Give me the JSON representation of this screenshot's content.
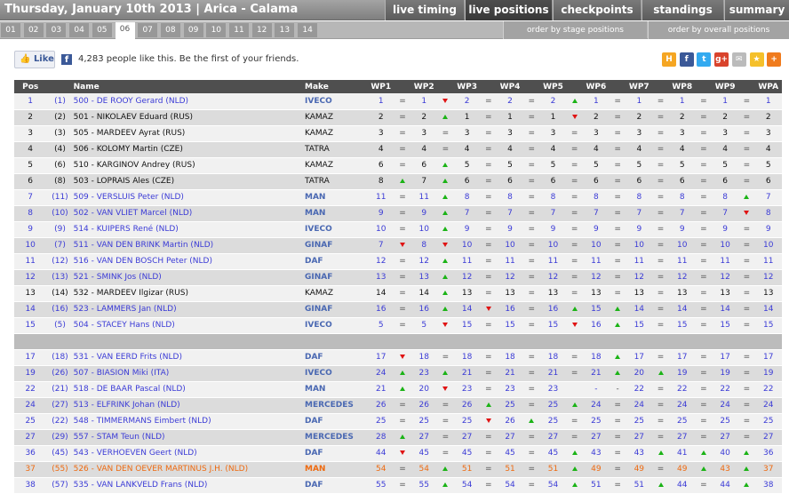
{
  "header": {
    "title": "Thursday, January 10th 2013 | Arica - Calama",
    "tabs": [
      "live timing",
      "live positions",
      "checkpoints",
      "standings",
      "summary"
    ],
    "active_tab": "live positions"
  },
  "stages": {
    "items": [
      "01",
      "02",
      "03",
      "04",
      "05",
      "06",
      "07",
      "08",
      "09",
      "10",
      "11",
      "12",
      "13",
      "14"
    ],
    "active": "06",
    "order_stage": "order by stage positions",
    "order_overall": "order by overall positions"
  },
  "facebook": {
    "like_label": "Like",
    "fb_glyph": "f",
    "like_text": "4,283 people like this. Be the first of your friends."
  },
  "share_icons": [
    {
      "name": "hyves-icon",
      "glyph": "H",
      "color": "#f5a623"
    },
    {
      "name": "facebook-share-icon",
      "glyph": "f",
      "color": "#3b5998"
    },
    {
      "name": "twitter-icon",
      "glyph": "t",
      "color": "#33aaf0"
    },
    {
      "name": "google-plus-icon",
      "glyph": "g+",
      "color": "#d9432c"
    },
    {
      "name": "email-icon",
      "glyph": "✉",
      "color": "#bbbbbb"
    },
    {
      "name": "favorite-star-icon",
      "glyph": "★",
      "color": "#f5c02b"
    },
    {
      "name": "more-plus-icon",
      "glyph": "+",
      "color": "#f07b1d"
    }
  ],
  "table": {
    "headers": {
      "pos": "Pos",
      "name": "Name",
      "make": "Make",
      "wps": [
        "WP1",
        "WP2",
        "WP3",
        "WP4",
        "WP5",
        "WP6",
        "WP7",
        "WP8",
        "WP9",
        "WPA"
      ]
    },
    "rows": [
      {
        "pos": "1",
        "ov": "(1)",
        "name": "500 - DE ROOY Gerard (NLD)",
        "make": "IVECO",
        "style": "blue",
        "wp": [
          "1",
          "1",
          "2",
          "2",
          "2",
          "1",
          "1",
          "1",
          "1",
          "1"
        ],
        "ch": [
          "=",
          "v",
          "=",
          "=",
          "^",
          "=",
          "=",
          "=",
          "="
        ]
      },
      {
        "pos": "2",
        "ov": "(2)",
        "name": "501 - NIKOLAEV Eduard (RUS)",
        "make": "KAMAZ",
        "style": "black",
        "wp": [
          "2",
          "2",
          "1",
          "1",
          "1",
          "2",
          "2",
          "2",
          "2",
          "2"
        ],
        "ch": [
          "=",
          "^",
          "=",
          "=",
          "v",
          "=",
          "=",
          "=",
          "="
        ]
      },
      {
        "pos": "3",
        "ov": "(3)",
        "name": "505 - MARDEEV Ayrat (RUS)",
        "make": "KAMAZ",
        "style": "black",
        "wp": [
          "3",
          "3",
          "3",
          "3",
          "3",
          "3",
          "3",
          "3",
          "3",
          "3"
        ],
        "ch": [
          "=",
          "=",
          "=",
          "=",
          "=",
          "=",
          "=",
          "=",
          "="
        ]
      },
      {
        "pos": "4",
        "ov": "(4)",
        "name": "506 - KOLOMY Martin (CZE)",
        "make": "TATRA",
        "style": "black",
        "wp": [
          "4",
          "4",
          "4",
          "4",
          "4",
          "4",
          "4",
          "4",
          "4",
          "4"
        ],
        "ch": [
          "=",
          "=",
          "=",
          "=",
          "=",
          "=",
          "=",
          "=",
          "="
        ]
      },
      {
        "pos": "5",
        "ov": "(6)",
        "name": "510 - KARGINOV Andrey (RUS)",
        "make": "KAMAZ",
        "style": "black",
        "wp": [
          "6",
          "6",
          "5",
          "5",
          "5",
          "5",
          "5",
          "5",
          "5",
          "5"
        ],
        "ch": [
          "=",
          "^",
          "=",
          "=",
          "=",
          "=",
          "=",
          "=",
          "="
        ]
      },
      {
        "pos": "6",
        "ov": "(8)",
        "name": "503 - LOPRAIS Ales (CZE)",
        "make": "TATRA",
        "style": "black",
        "wp": [
          "8",
          "7",
          "6",
          "6",
          "6",
          "6",
          "6",
          "6",
          "6",
          "6"
        ],
        "ch": [
          "^",
          "^",
          "=",
          "=",
          "=",
          "=",
          "=",
          "=",
          "="
        ]
      },
      {
        "pos": "7",
        "ov": "(11)",
        "name": "509 - VERSLUIS Peter (NLD)",
        "make": "MAN",
        "style": "blue",
        "wp": [
          "11",
          "11",
          "8",
          "8",
          "8",
          "8",
          "8",
          "8",
          "8",
          "7"
        ],
        "ch": [
          "=",
          "^",
          "=",
          "=",
          "=",
          "=",
          "=",
          "=",
          "^"
        ]
      },
      {
        "pos": "8",
        "ov": "(10)",
        "name": "502 - VAN VLIET Marcel (NLD)",
        "make": "MAN",
        "style": "blue",
        "wp": [
          "9",
          "9",
          "7",
          "7",
          "7",
          "7",
          "7",
          "7",
          "7",
          "8"
        ],
        "ch": [
          "=",
          "^",
          "=",
          "=",
          "=",
          "=",
          "=",
          "=",
          "v"
        ]
      },
      {
        "pos": "9",
        "ov": "(9)",
        "name": "514 - KUIPERS René (NLD)",
        "make": "IVECO",
        "style": "blue",
        "wp": [
          "10",
          "10",
          "9",
          "9",
          "9",
          "9",
          "9",
          "9",
          "9",
          "9"
        ],
        "ch": [
          "=",
          "^",
          "=",
          "=",
          "=",
          "=",
          "=",
          "=",
          "="
        ]
      },
      {
        "pos": "10",
        "ov": "(7)",
        "name": "511 - VAN DEN BRINK Martin (NLD)",
        "make": "GINAF",
        "style": "blue",
        "wp": [
          "7",
          "8",
          "10",
          "10",
          "10",
          "10",
          "10",
          "10",
          "10",
          "10"
        ],
        "ch": [
          "v",
          "v",
          "=",
          "=",
          "=",
          "=",
          "=",
          "=",
          "="
        ]
      },
      {
        "pos": "11",
        "ov": "(12)",
        "name": "516 - VAN DEN BOSCH Peter (NLD)",
        "make": "DAF",
        "style": "blue",
        "wp": [
          "12",
          "12",
          "11",
          "11",
          "11",
          "11",
          "11",
          "11",
          "11",
          "11"
        ],
        "ch": [
          "=",
          "^",
          "=",
          "=",
          "=",
          "=",
          "=",
          "=",
          "="
        ]
      },
      {
        "pos": "12",
        "ov": "(13)",
        "name": "521 - SMINK Jos (NLD)",
        "make": "GINAF",
        "style": "blue",
        "wp": [
          "13",
          "13",
          "12",
          "12",
          "12",
          "12",
          "12",
          "12",
          "12",
          "12"
        ],
        "ch": [
          "=",
          "^",
          "=",
          "=",
          "=",
          "=",
          "=",
          "=",
          "="
        ]
      },
      {
        "pos": "13",
        "ov": "(14)",
        "name": "532 - MARDEEV Ilgizar (RUS)",
        "make": "KAMAZ",
        "style": "black",
        "wp": [
          "14",
          "14",
          "13",
          "13",
          "13",
          "13",
          "13",
          "13",
          "13",
          "13"
        ],
        "ch": [
          "=",
          "^",
          "=",
          "=",
          "=",
          "=",
          "=",
          "=",
          "="
        ]
      },
      {
        "pos": "14",
        "ov": "(16)",
        "name": "523 - LAMMERS Jan (NLD)",
        "make": "GINAF",
        "style": "blue",
        "wp": [
          "16",
          "16",
          "14",
          "16",
          "16",
          "15",
          "14",
          "14",
          "14",
          "14"
        ],
        "ch": [
          "=",
          "^",
          "v",
          "=",
          "^",
          "^",
          "=",
          "=",
          "="
        ]
      },
      {
        "pos": "15",
        "ov": "(5)",
        "name": "504 - STACEY Hans (NLD)",
        "make": "IVECO",
        "style": "blue",
        "wp": [
          "5",
          "5",
          "15",
          "15",
          "15",
          "16",
          "15",
          "15",
          "15",
          "15"
        ],
        "ch": [
          "=",
          "v",
          "=",
          "=",
          "v",
          "^",
          "=",
          "=",
          "="
        ]
      },
      {
        "pos": "17",
        "ov": "(18)",
        "name": "531 - VAN EERD Frits (NLD)",
        "make": "DAF",
        "style": "blue",
        "wp": [
          "17",
          "18",
          "18",
          "18",
          "18",
          "18",
          "17",
          "17",
          "17",
          "17"
        ],
        "ch": [
          "v",
          "=",
          "=",
          "=",
          "=",
          "^",
          "=",
          "=",
          "="
        ]
      },
      {
        "pos": "19",
        "ov": "(26)",
        "name": "507 - BIASION Miki (ITA)",
        "make": "IVECO",
        "style": "blue",
        "wp": [
          "24",
          "23",
          "21",
          "21",
          "21",
          "21",
          "20",
          "19",
          "19",
          "19"
        ],
        "ch": [
          "^",
          "^",
          "=",
          "=",
          "=",
          "^",
          "^",
          "=",
          "="
        ]
      },
      {
        "pos": "22",
        "ov": "(21)",
        "name": "518 - DE BAAR Pascal (NLD)",
        "make": "MAN",
        "style": "blue",
        "wp": [
          "21",
          "20",
          "23",
          "23",
          "23",
          "-",
          "22",
          "22",
          "22",
          "22"
        ],
        "ch": [
          "^",
          "v",
          "=",
          "=",
          "",
          "-",
          "=",
          "=",
          "="
        ]
      },
      {
        "pos": "24",
        "ov": "(27)",
        "name": "513 - ELFRINK Johan (NLD)",
        "make": "MERCEDES",
        "style": "blue",
        "wp": [
          "26",
          "26",
          "26",
          "25",
          "25",
          "24",
          "24",
          "24",
          "24",
          "24"
        ],
        "ch": [
          "=",
          "=",
          "^",
          "=",
          "^",
          "=",
          "=",
          "=",
          "="
        ]
      },
      {
        "pos": "25",
        "ov": "(22)",
        "name": "548 - TIMMERMANS Eimbert (NLD)",
        "make": "DAF",
        "style": "blue",
        "wp": [
          "25",
          "25",
          "25",
          "26",
          "25",
          "25",
          "25",
          "25",
          "25",
          "25"
        ],
        "ch": [
          "=",
          "=",
          "v",
          "^",
          "=",
          "=",
          "=",
          "=",
          "="
        ]
      },
      {
        "pos": "27",
        "ov": "(29)",
        "name": "557 - STAM Teun (NLD)",
        "make": "MERCEDES",
        "style": "blue",
        "wp": [
          "28",
          "27",
          "27",
          "27",
          "27",
          "27",
          "27",
          "27",
          "27",
          "27"
        ],
        "ch": [
          "^",
          "=",
          "=",
          "=",
          "=",
          "=",
          "=",
          "=",
          "="
        ]
      },
      {
        "pos": "36",
        "ov": "(45)",
        "name": "543 - VERHOEVEN Geert (NLD)",
        "make": "DAF",
        "style": "blue",
        "wp": [
          "44",
          "45",
          "45",
          "45",
          "45",
          "43",
          "43",
          "41",
          "40",
          "36"
        ],
        "ch": [
          "v",
          "=",
          "=",
          "=",
          "^",
          "=",
          "^",
          "^",
          "^"
        ]
      },
      {
        "pos": "37",
        "ov": "(55)",
        "name": "526 - VAN DEN OEVER MARTINUS J.H. (NLD)",
        "make": "MAN",
        "style": "orange",
        "wp": [
          "54",
          "54",
          "51",
          "51",
          "51",
          "49",
          "49",
          "49",
          "43",
          "37"
        ],
        "ch": [
          "=",
          "^",
          "=",
          "=",
          "^",
          "=",
          "=",
          "^",
          "^"
        ]
      },
      {
        "pos": "38",
        "ov": "(57)",
        "name": "535 - VAN LANKVELD Frans (NLD)",
        "make": "DAF",
        "style": "blue",
        "wp": [
          "55",
          "55",
          "54",
          "54",
          "54",
          "51",
          "51",
          "44",
          "44",
          "38"
        ],
        "ch": [
          "=",
          "^",
          "=",
          "=",
          "^",
          "=",
          "^",
          "=",
          "^"
        ]
      }
    ]
  }
}
